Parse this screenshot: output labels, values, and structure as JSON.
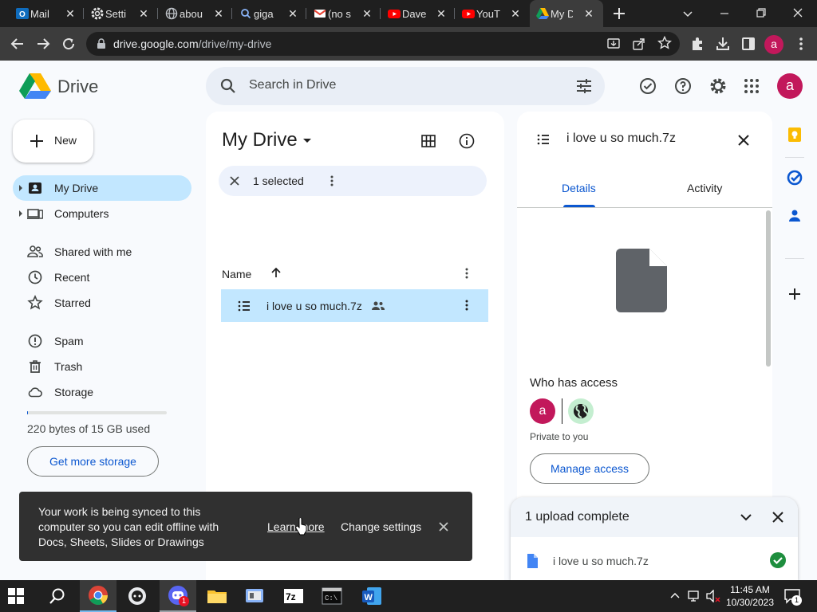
{
  "browser": {
    "tabs": [
      {
        "title": "Mail",
        "icon": "outlook-icon"
      },
      {
        "title": "Setti",
        "icon": "gear-icon"
      },
      {
        "title": "abou",
        "icon": "globe-icon"
      },
      {
        "title": "giga",
        "icon": "search-icon"
      },
      {
        "title": "(no s",
        "icon": "gmail-icon"
      },
      {
        "title": "Dave",
        "icon": "youtube-icon"
      },
      {
        "title": "YouT",
        "icon": "youtube-icon"
      },
      {
        "title": "My D",
        "icon": "drive-icon",
        "active": true
      }
    ],
    "url_host": "drive.google.com",
    "url_path": "/drive/my-drive",
    "profile_initial": "a"
  },
  "drive": {
    "app_title": "Drive",
    "search_placeholder": "Search in Drive",
    "profile_initial": "a",
    "new_label": "New",
    "nav": [
      {
        "label": "My Drive",
        "icon": "my-drive-icon",
        "selected": true,
        "expandable": true
      },
      {
        "label": "Computers",
        "icon": "computers-icon",
        "expandable": true
      },
      {
        "label": "Shared with me",
        "icon": "shared-icon"
      },
      {
        "label": "Recent",
        "icon": "clock-icon"
      },
      {
        "label": "Starred",
        "icon": "star-icon"
      },
      {
        "label": "Spam",
        "icon": "spam-icon"
      },
      {
        "label": "Trash",
        "icon": "trash-icon"
      },
      {
        "label": "Storage",
        "icon": "cloud-icon"
      }
    ],
    "storage_text": "220 bytes of 15 GB used",
    "storage_fraction": 0.0,
    "get_storage_label": "Get more storage",
    "main": {
      "title": "My Drive",
      "selected_text": "1 selected",
      "column_name": "Name",
      "files": [
        {
          "name": "i love u so much.7z",
          "shared": true,
          "selected": true
        }
      ]
    },
    "details": {
      "file_name": "i love u so much.7z",
      "tab_details": "Details",
      "tab_activity": "Activity",
      "access_title": "Who has access",
      "owner_initial": "a",
      "private_text": "Private to you",
      "manage_label": "Manage access"
    },
    "upload": {
      "title": "1 upload complete",
      "file_name": "i love u so much.7z"
    },
    "snackbar": {
      "message": "Your work is being synced to this computer so you can edit offline with Docs, Sheets, Slides or Drawings",
      "learn_more": "Learn more",
      "change_settings": "Change settings"
    }
  },
  "taskbar": {
    "time": "11:45 AM",
    "date": "10/30/2023",
    "notification_count": "1",
    "discord_badge": "1"
  },
  "colors": {
    "accent": "#0b57d0",
    "selected": "#c2e7ff",
    "avatar": "#c2185b",
    "check": "#1e8e3e"
  }
}
